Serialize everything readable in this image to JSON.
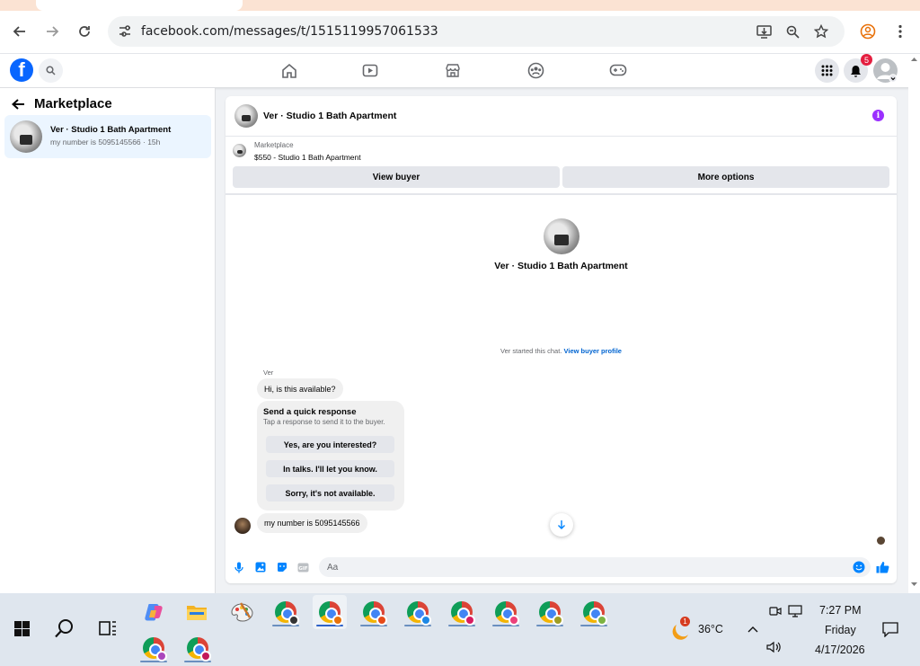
{
  "browser": {
    "url": "facebook.com/messages/t/1515119957061533",
    "notification_count": "5"
  },
  "left_panel": {
    "title": "Marketplace",
    "conversation": {
      "name": "Ver · Studio 1 Bath Apartment",
      "snippet": "my number is 5095145566 · 15h"
    }
  },
  "chat": {
    "title": "Ver · Studio 1 Bath Apartment",
    "listing_kind": "Marketplace",
    "listing_title": "$550 - Studio 1 Bath Apartment",
    "view_buyer_label": "View buyer",
    "more_options_label": "More options",
    "profile_name": "Ver · Studio 1 Bath Apartment",
    "started_text": "Ver started this chat.",
    "started_link": "View buyer profile",
    "sender_name": "Ver",
    "messages": [
      "Hi, is this available?",
      "my number is 5095145566"
    ],
    "quick_response": {
      "title": "Send a quick response",
      "subtitle": "Tap a response to send it to the buyer.",
      "options": [
        "Yes, are you interested?",
        "In talks. I'll let you know.",
        "Sorry, it's not available."
      ]
    },
    "composer_placeholder": "Aa"
  },
  "taskbar": {
    "weather_badge": "1",
    "temperature": "36°C",
    "time": "7:27 PM",
    "day": "Friday",
    "date": "4/17/2026"
  },
  "colors": {
    "fb_blue": "#0866ff",
    "messenger_accent": "#0084ff",
    "selected_bg": "#ebf5ff",
    "badge_red": "#e41e3f",
    "info_purple": "#9b30ff"
  }
}
